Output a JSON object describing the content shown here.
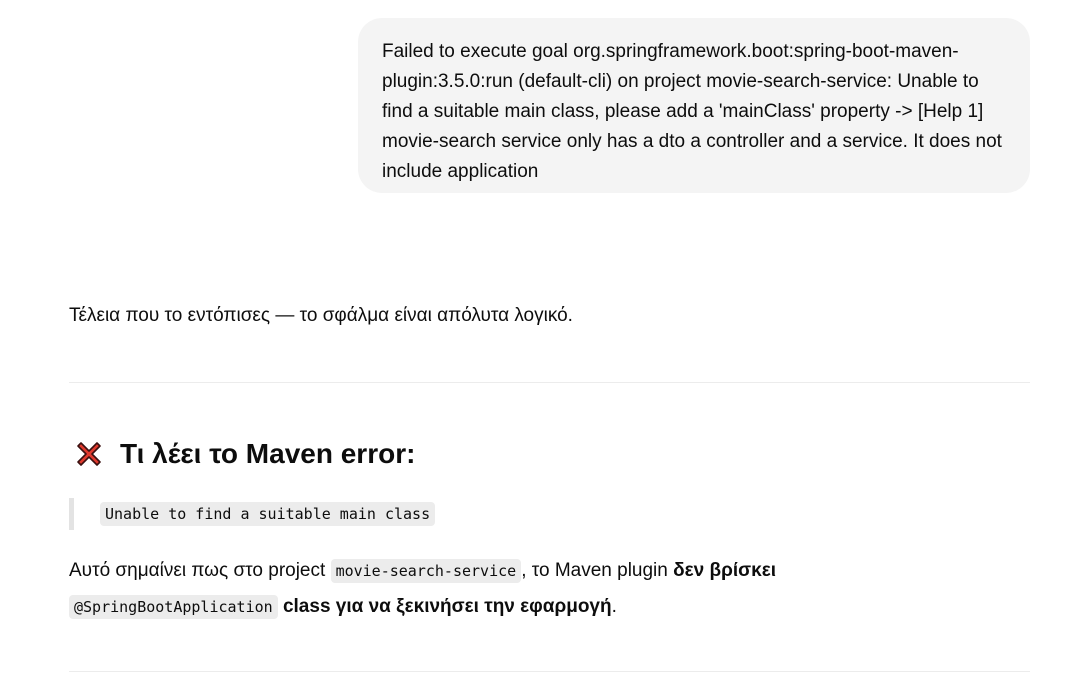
{
  "user_message": {
    "text": "Failed to execute goal org.springframework.boot:spring-boot-maven-plugin:3.5.0:run (default-cli) on project movie-search-service: Unable to find a suitable main class, please add a 'mainClass' property -> [Help 1] movie-search service only has a dto a controller and a service. It does not include application"
  },
  "assistant": {
    "intro": "Τέλεια που το εντόπισες — το σφάλμα είναι απόλυτα λογικό.",
    "section_heading": "Τι λέει το Maven error:",
    "section_icon": "cross-mark-icon",
    "quote_code": "Unable to find a suitable main class",
    "para": {
      "part1": "Αυτό σημαίνει πως στο project ",
      "code1": "movie-search-service",
      "part2": ", το Maven plugin ",
      "bold1": "δεν βρίσκει",
      "code2": "@SpringBootApplication",
      "bold2": " class για να ξεκινήσει την εφαρμογή",
      "end": "."
    }
  },
  "colors": {
    "bubble_bg": "#f4f4f4",
    "text": "#0d0d0d",
    "icon_red": "#e03a2e",
    "code_bg": "#ececec"
  }
}
